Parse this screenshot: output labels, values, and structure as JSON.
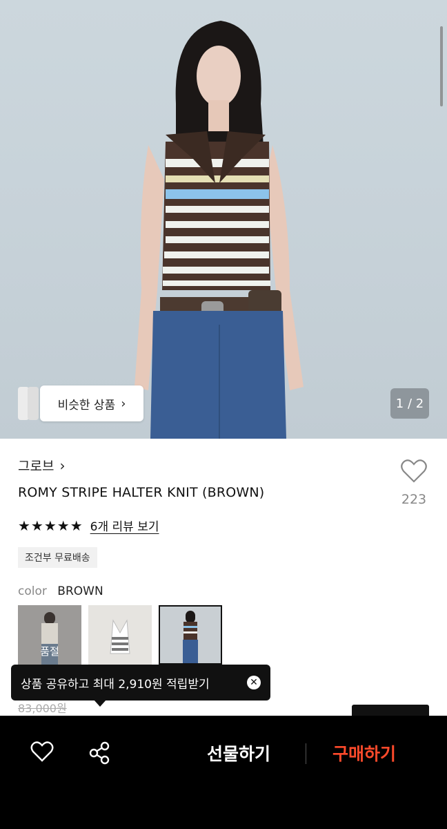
{
  "hero": {
    "similar_label": "비슷한 상품",
    "counter": "1 / 2"
  },
  "product": {
    "brand": "그로브",
    "title": "ROMY STRIPE HALTER KNIT (BROWN)",
    "wish_count": "223",
    "rating_stars": "★★★★★",
    "review_link": "6개 리뷰 보기",
    "shipping_badge": "조건부 무료배송",
    "color_label": "color",
    "color_value": "BROWN",
    "swatches": [
      {
        "label": "품절"
      }
    ],
    "old_price": "83,000원"
  },
  "tooltip": {
    "text": "상품 공유하고 최대 2,910원 적립받기"
  },
  "bottom_bar": {
    "gift_label": "선물하기",
    "buy_label": "구매하기"
  },
  "colors": {
    "buy_accent": "#ff4a2b",
    "bar_bg": "#000000"
  },
  "icons": [
    "chevron-right-icon",
    "heart-icon",
    "share-icon",
    "close-icon",
    "star-icon"
  ]
}
